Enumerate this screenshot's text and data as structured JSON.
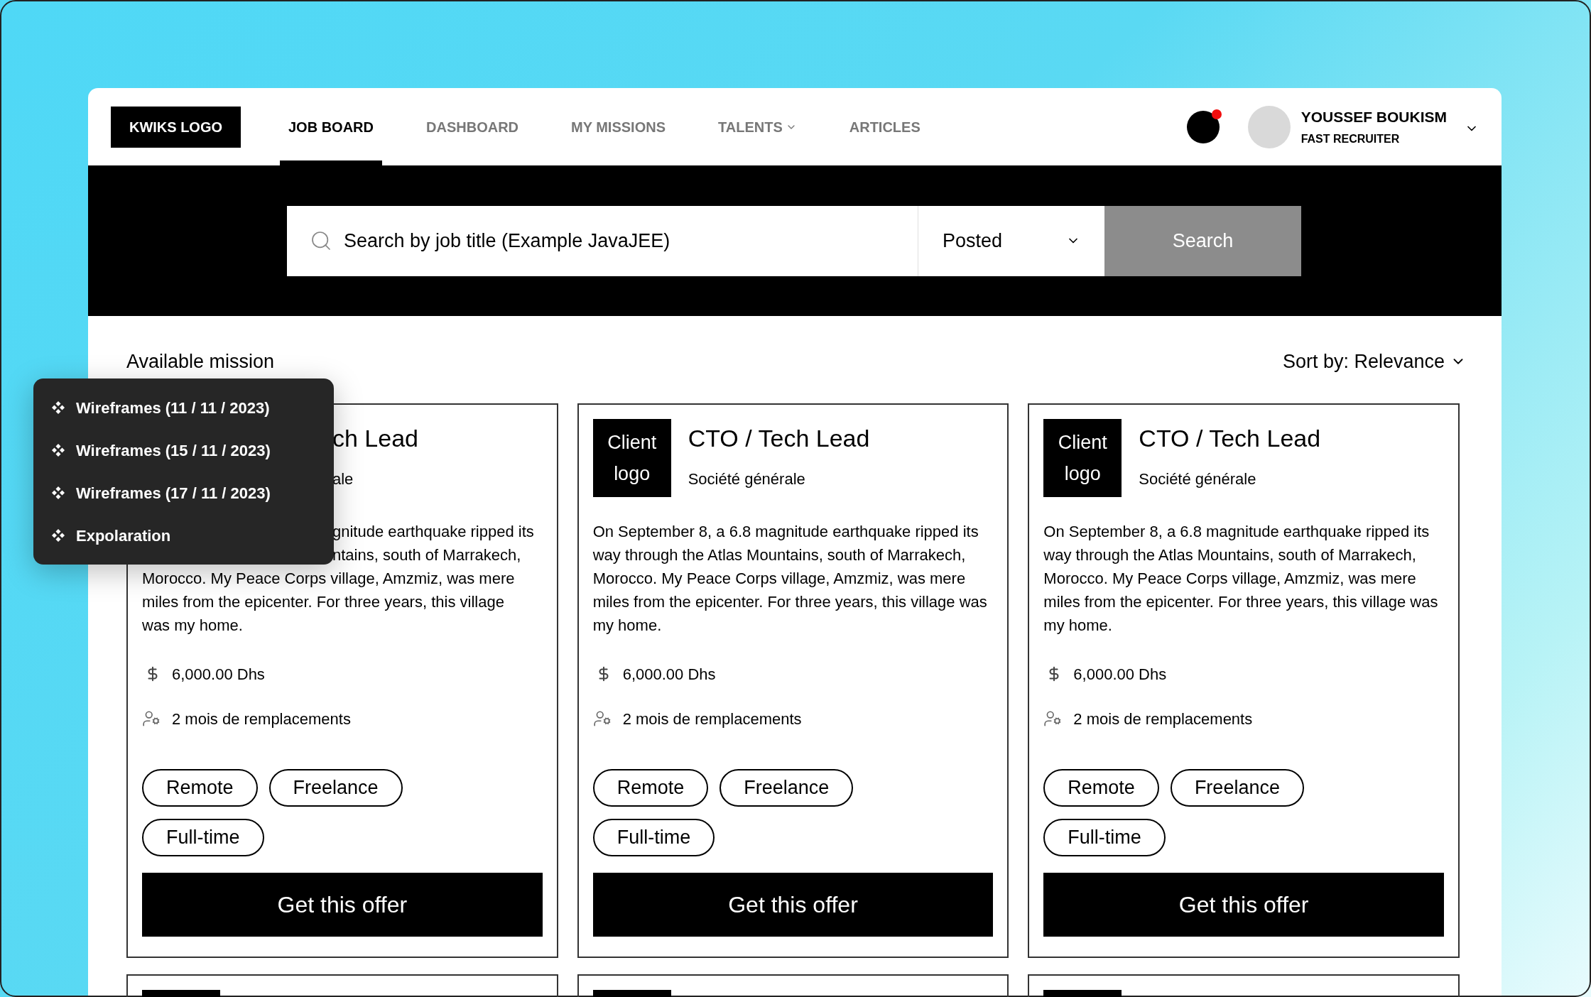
{
  "header": {
    "logo": "KWIKS LOGO",
    "nav": [
      {
        "label": "JOB BOARD",
        "selected": true,
        "dropdown": false
      },
      {
        "label": "DASHBOARD",
        "selected": false,
        "dropdown": false
      },
      {
        "label": "MY MISSIONS",
        "selected": false,
        "dropdown": false
      },
      {
        "label": "TALENTS",
        "selected": false,
        "dropdown": true
      },
      {
        "label": "ARTICLES",
        "selected": false,
        "dropdown": false
      }
    ],
    "notification": {
      "unread": true
    },
    "user": {
      "name": "YOUSSEF BOUKISM",
      "role": "FAST RECRUITER"
    }
  },
  "search": {
    "placeholder": "Search by job title (Example JavaJEE)",
    "filter": "Posted",
    "button": "Search"
  },
  "section_title": "Available mission",
  "sort": "Sort by: Relevance",
  "popup_menu": [
    "Wireframes (11 / 11 / 2023)",
    "Wireframes (15 / 11 / 2023)",
    "Wireframes (17 / 11 / 2023)",
    "Expolaration"
  ],
  "cards": [
    {
      "kind": "covered",
      "title": "ch Lead",
      "company": "ale",
      "covered_lines": [
        "gnitude earthquake ripped its",
        "ntains, south of Marrakech,"
      ],
      "lines": [
        "Morocco. My Peace Corps village, Amzmiz, was mere",
        "miles from the epicenter. For three years, this village",
        "was my home."
      ],
      "salary": "6,000.00 Dhs",
      "duration": "2 mois de remplacements",
      "tags": [
        "Remote",
        "Freelance",
        "Full-time"
      ],
      "button": "Get this offer"
    },
    {
      "kind": "full",
      "logo": "Client logo",
      "title": "CTO / Tech Lead",
      "company": "Société générale",
      "description": "On September 8, a 6.8 magnitude earthquake ripped its way through the Atlas Mountains, south of Marrakech, Morocco. My Peace Corps village, Amzmiz, was mere miles from the epicenter. For three years, this village was my home.",
      "salary": "6,000.00 Dhs",
      "duration": "2 mois de remplacements",
      "tags": [
        "Remote",
        "Freelance",
        "Full-time"
      ],
      "button": "Get this offer"
    },
    {
      "kind": "full",
      "logo": "Client logo",
      "title": "CTO / Tech Lead",
      "company": "Société générale",
      "description": "On September 8, a 6.8 magnitude earthquake ripped its way through the Atlas Mountains, south of Marrakech, Morocco. My Peace Corps village, Amzmiz, was mere miles from the epicenter. For three years, this village was my home.",
      "salary": "6,000.00 Dhs",
      "duration": "2 mois de remplacements",
      "tags": [
        "Remote",
        "Freelance",
        "Full-time"
      ],
      "button": "Get this offer"
    },
    {
      "kind": "stub"
    },
    {
      "kind": "stub"
    },
    {
      "kind": "stub"
    }
  ]
}
